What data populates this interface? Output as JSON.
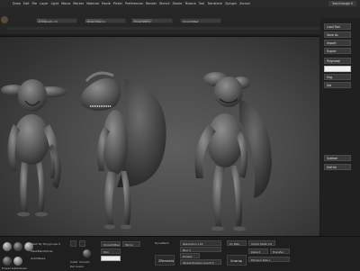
{
  "menubar": {
    "items": [
      "Draw",
      "Edit",
      "File",
      "Layer",
      "Light",
      "Macro",
      "Marker",
      "Material",
      "Movie",
      "Picker",
      "Preferences",
      "Render",
      "Stencil",
      "Stroke",
      "Texture",
      "Tool",
      "Transform",
      "Zplugin",
      "Zscript"
    ],
    "right_a": "",
    "right_b": "See-through 0"
  },
  "toolbar": {
    "slider1": {
      "label": "Z Intensity",
      "value": "25"
    },
    "slider2": {
      "label": "Draw Size",
      "value": "64"
    },
    "slider3": {
      "label": "Focal Shift",
      "value": "0"
    },
    "slider4": {
      "label": "SmoothMat",
      "value": ""
    }
  },
  "right_panel": {
    "btn1": "Load Tool",
    "btn2": "Save As",
    "btn3": "Import",
    "btn4": "Export",
    "btn5": "Polymesh",
    "btn6": "",
    "btn7": "Mrg",
    "btn8": "Del",
    "btn9": "Subtool",
    "btn10": "DelHid"
  },
  "bottom": {
    "mesh_label": "Mesh By Polygroups 0",
    "mask_label": "MaskBlendMode",
    "auto_label": "AutoMasks",
    "sub_lbl1": "SubD",
    "sub_lbl2": "Del Lower",
    "sub_lbl3": "Smooth",
    "freeze_label": "Freeze SubDivision",
    "smooth_btn": "SmoothMesh",
    "mirror_btn": "Mirror",
    "btn3": "Mrg",
    "dyna_label": "DynaMesh",
    "res_label": "Resolution",
    "res_value": "128",
    "blur_label": "Blur",
    "blur_value": "2",
    "project_label": "Project",
    "tpc_label": "Target Polygon Count",
    "tpc_value": "5",
    "zremesher_label": "ZRemesher",
    "remesh_label": "Remesh",
    "polygroups_label": "Polygroups",
    "uv_btn": "Uv Map",
    "check_btn": "Check Mesh Int",
    "adaptive_btn": "AdaptiveSize",
    "c1": "Detect",
    "c2": "Transfer",
    "polygroup_size_label": "Polygon Size",
    "polygroup_size_value": "1",
    "unwrap_label": "Unwrap"
  }
}
